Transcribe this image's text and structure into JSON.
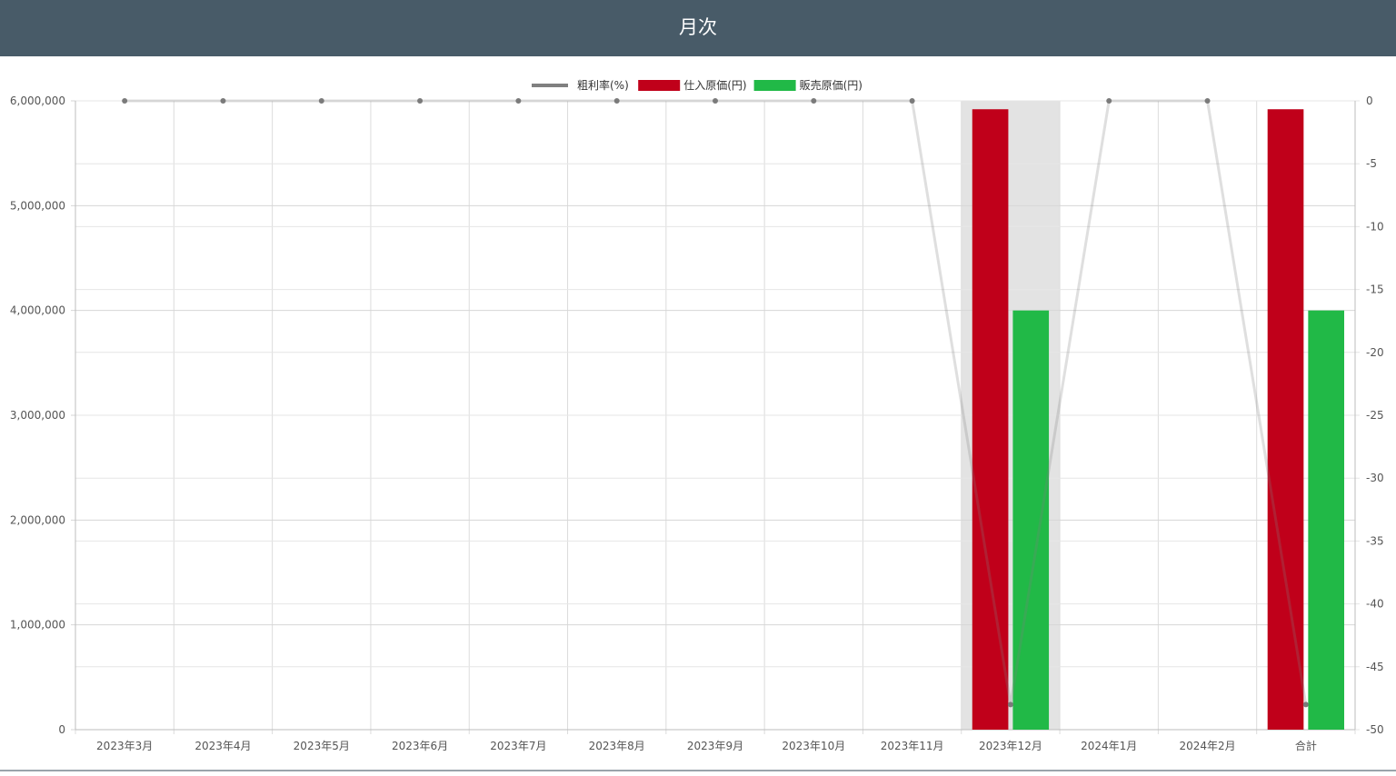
{
  "header": {
    "title": "月次"
  },
  "chart_data": {
    "type": "bar",
    "categories": [
      "2023年3月",
      "2023年4月",
      "2023年5月",
      "2023年6月",
      "2023年7月",
      "2023年8月",
      "2023年9月",
      "2023年10月",
      "2023年11月",
      "2023年12月",
      "2024年1月",
      "2024年2月",
      "合計"
    ],
    "series": [
      {
        "name": "粗利率(%)",
        "type": "line",
        "axis": "right",
        "color": "#808080",
        "values": [
          0,
          0,
          0,
          0,
          0,
          0,
          0,
          0,
          0,
          -48,
          0,
          0,
          -48
        ]
      },
      {
        "name": "仕入原価(円)",
        "type": "bar",
        "axis": "left",
        "color": "#c0001a",
        "values": [
          0,
          0,
          0,
          0,
          0,
          0,
          0,
          0,
          0,
          5920000,
          0,
          0,
          5920000
        ]
      },
      {
        "name": "販売原価(円)",
        "type": "bar",
        "axis": "left",
        "color": "#21b947",
        "values": [
          0,
          0,
          0,
          0,
          0,
          0,
          0,
          0,
          0,
          4000000,
          0,
          0,
          4000000
        ]
      }
    ],
    "y_left": {
      "ylim": [
        0,
        6000000
      ],
      "ticks": [
        "0",
        "1,000,000",
        "2,000,000",
        "3,000,000",
        "4,000,000",
        "5,000,000",
        "6,000,000"
      ]
    },
    "y_right": {
      "ylim": [
        -50,
        0
      ],
      "ticks": [
        "0",
        "-5",
        "-10",
        "-15",
        "-20",
        "-25",
        "-30",
        "-35",
        "-40",
        "-45",
        "-50"
      ]
    },
    "highlighted_category": "2023年12月",
    "legend": "top-center",
    "grid": true
  }
}
